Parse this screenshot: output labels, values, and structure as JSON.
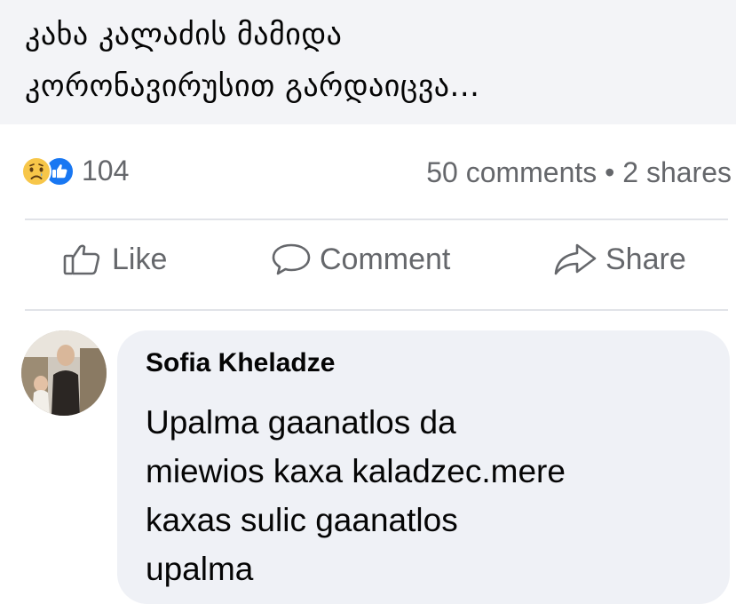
{
  "post": {
    "text_line1": "კახა კალაძის მამიდა",
    "text_line2": "კორონავირუსით გარდაიცვა..."
  },
  "reactions": {
    "icons": [
      "sad-reaction-icon",
      "like-reaction-icon"
    ],
    "count": "104"
  },
  "counts": {
    "summary": "50 comments • 2 shares"
  },
  "actions": {
    "like_label": "Like",
    "comment_label": "Comment",
    "share_label": "Share"
  },
  "comment": {
    "author": "Sofia Kheladze",
    "line1": "Upalma gaanatlos da",
    "line2": "miewios kaxa kaladzec.mere",
    "line3": "kaxas sulic gaanatlos",
    "line4": "upalma"
  },
  "colors": {
    "header_bg": "#f3f4f7",
    "muted_text": "#65676b",
    "like_blue": "#1877f2",
    "sad_yellow": "#f7c649",
    "bubble_bg": "#eff1f6"
  }
}
